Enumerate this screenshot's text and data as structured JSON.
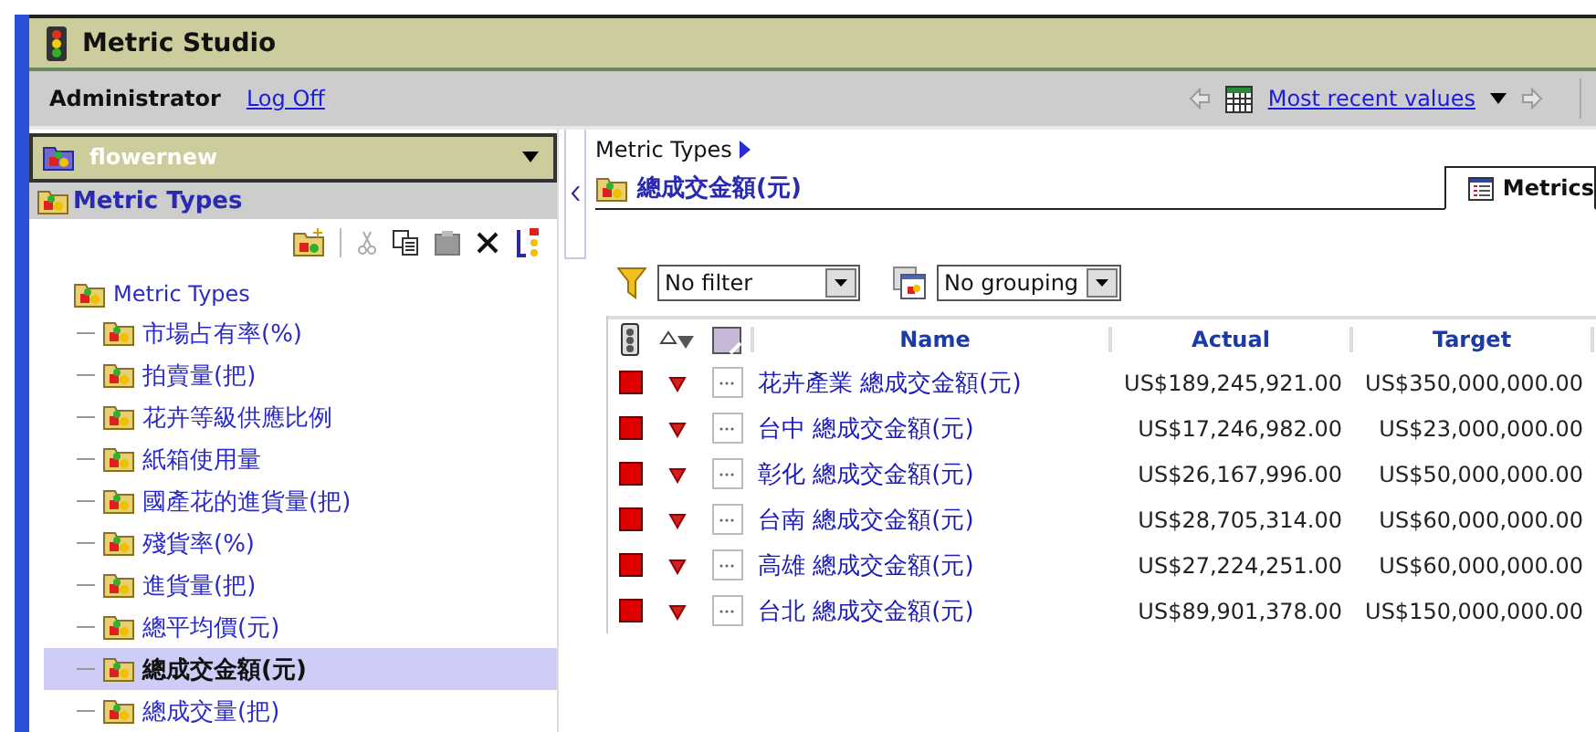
{
  "window": {
    "title": "Metric Studio"
  },
  "user_bar": {
    "user": "Administrator",
    "logoff": "Log Off",
    "period": "Most recent values"
  },
  "left_panel": {
    "scorecard": "flowernew",
    "section_title": "Metric Types",
    "tree": {
      "label": "Metric Types",
      "children": [
        {
          "label": "市場占有率(%)",
          "selected": false
        },
        {
          "label": "拍賣量(把)",
          "selected": false
        },
        {
          "label": "花卉等級供應比例",
          "selected": false
        },
        {
          "label": "紙箱使用量",
          "selected": false
        },
        {
          "label": "國產花的進貨量(把)",
          "selected": false
        },
        {
          "label": "殘貨率(%)",
          "selected": false
        },
        {
          "label": "進貨量(把)",
          "selected": false
        },
        {
          "label": "總平均價(元)",
          "selected": false
        },
        {
          "label": "總成交金額(元)",
          "selected": true
        },
        {
          "label": "總成交量(把)",
          "selected": false
        }
      ]
    }
  },
  "right_panel": {
    "breadcrumb": "Metric Types",
    "title": "總成交金額(元)",
    "tabs": [
      {
        "label": "Metrics",
        "selected": true
      }
    ],
    "filter": "No filter",
    "grouping": "No grouping",
    "table": {
      "columns": [
        "Name",
        "Actual",
        "Target"
      ],
      "rows": [
        {
          "color": "#e00000",
          "declining": true,
          "name": "花卉產業 總成交金額(元)",
          "actual": "US$189,245,921.00",
          "target": "US$350,000,000.00"
        },
        {
          "color": "#e00000",
          "declining": true,
          "name": "台中 總成交金額(元)",
          "actual": "US$17,246,982.00",
          "target": "US$23,000,000.00"
        },
        {
          "color": "#e00000",
          "declining": true,
          "name": "彰化 總成交金額(元)",
          "actual": "US$26,167,996.00",
          "target": "US$50,000,000.00"
        },
        {
          "color": "#e00000",
          "declining": true,
          "name": "台南 總成交金額(元)",
          "actual": "US$28,705,314.00",
          "target": "US$60,000,000.00"
        },
        {
          "color": "#e00000",
          "declining": true,
          "name": "高雄 總成交金額(元)",
          "actual": "US$27,224,251.00",
          "target": "US$60,000,000.00"
        },
        {
          "color": "#e00000",
          "declining": true,
          "name": "台北 總成交金額(元)",
          "actual": "US$89,901,378.00",
          "target": "US$150,000,000.00"
        }
      ]
    }
  }
}
